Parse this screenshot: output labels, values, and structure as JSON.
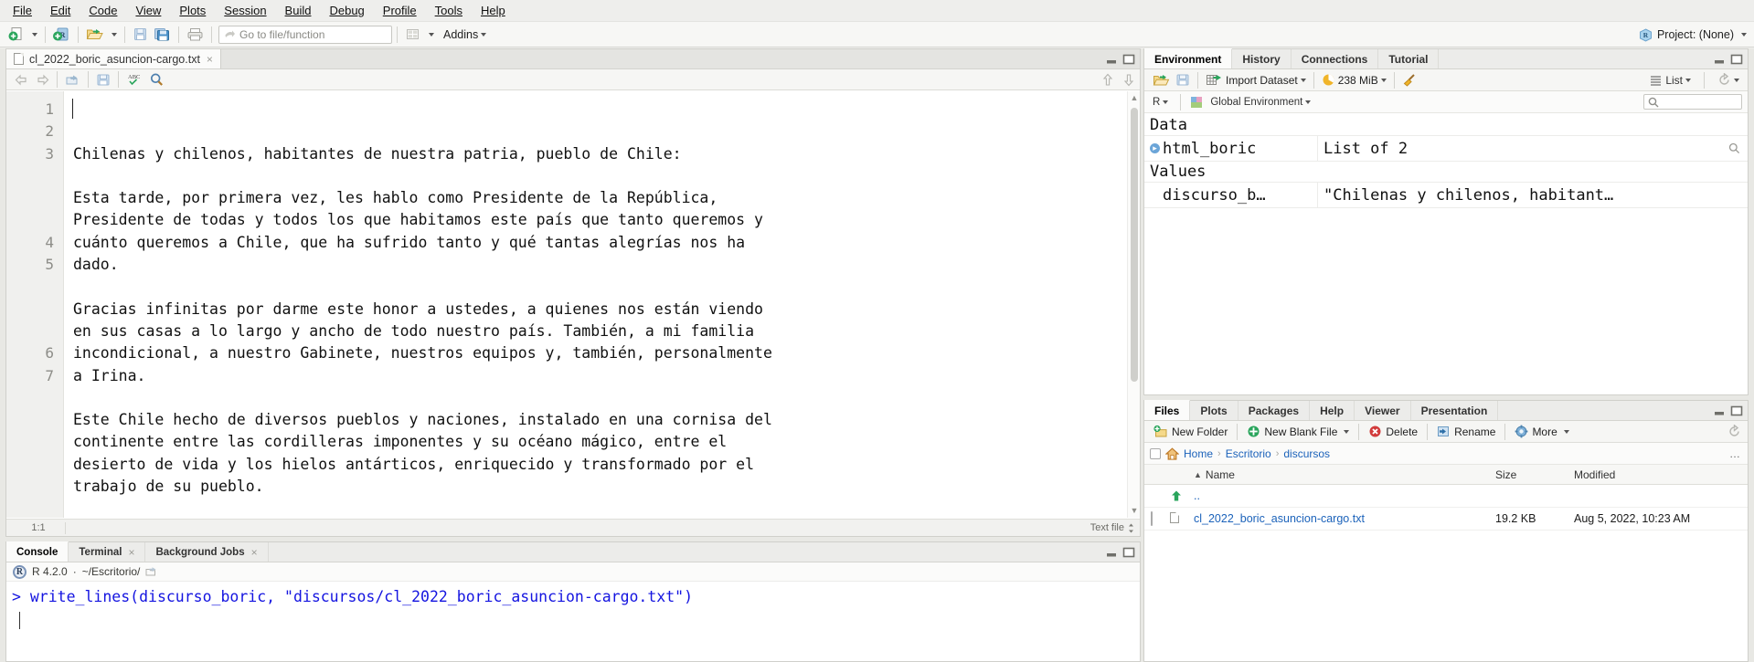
{
  "menubar": {
    "items": [
      "File",
      "Edit",
      "Code",
      "View",
      "Plots",
      "Session",
      "Build",
      "Debug",
      "Profile",
      "Tools",
      "Help"
    ]
  },
  "toolbar": {
    "goto_placeholder": "Go to file/function",
    "addins_label": "Addins",
    "project_label": "Project: (None)"
  },
  "source": {
    "tab_label": "cl_2022_boric_asuncion-cargo.txt",
    "tab_close": "×",
    "status_position": "1:1",
    "status_filetype": "Text file",
    "lines": [
      {
        "num": "1",
        "text": "Chilenas y chilenos, habitantes de nuestra patria, pueblo de Chile:"
      },
      {
        "num": "2",
        "text": ""
      },
      {
        "num": "3",
        "text": "Esta tarde, por primera vez, les hablo como Presidente de la República,\nPresidente de todas y todos los que habitamos este país que tanto queremos y\ncuánto queremos a Chile, que ha sufrido tanto y qué tantas alegrías nos ha\ndado."
      },
      {
        "num": "4",
        "text": ""
      },
      {
        "num": "5",
        "text": "Gracias infinitas por darme este honor a ustedes, a quienes nos están viendo\nen sus casas a lo largo y ancho de todo nuestro país. También, a mi familia\nincondicional, a nuestro Gabinete, nuestros equipos y, también, personalmente\na Irina."
      },
      {
        "num": "6",
        "text": ""
      },
      {
        "num": "7",
        "text": "Este Chile hecho de diversos pueblos y naciones, instalado en una cornisa del\ncontinente entre las cordilleras imponentes y su océano mágico, entre el\ndesierto de vida y los hielos antárticos, enriquecido y transformado por el\ntrabajo de su pueblo."
      }
    ]
  },
  "console": {
    "tabs": [
      {
        "label": "Console",
        "closable": false,
        "active": true
      },
      {
        "label": "Terminal",
        "closable": true,
        "active": false
      },
      {
        "label": "Background Jobs",
        "closable": true,
        "active": false
      }
    ],
    "close_glyph": "×",
    "r_version": "R 4.2.0",
    "separator": "·",
    "working_dir": "~/Escritorio/",
    "prompt_line": "> write_lines(discurso_boric, \"discursos/cl_2022_boric_asuncion-cargo.txt\")"
  },
  "environment": {
    "tabs": [
      "Environment",
      "History",
      "Connections",
      "Tutorial"
    ],
    "active_tab": "Environment",
    "import_dataset_label": "Import Dataset",
    "memory_label": "238 MiB",
    "view_mode_label": "List",
    "language_label": "R",
    "scope_label": "Global Environment",
    "search_placeholder": "",
    "groups": [
      {
        "title": "Data",
        "rows": [
          {
            "name": "html_boric",
            "value": "List of  2",
            "expandable": true,
            "has_view": true
          }
        ]
      },
      {
        "title": "Values",
        "rows": [
          {
            "name": "discurso_b…",
            "value": "\"Chilenas y chilenos, habitant…",
            "expandable": false,
            "has_view": false
          }
        ]
      }
    ]
  },
  "files": {
    "tabs": [
      "Files",
      "Plots",
      "Packages",
      "Help",
      "Viewer",
      "Presentation"
    ],
    "active_tab": "Files",
    "actions": [
      {
        "label": "New Folder",
        "icon": "new-folder-icon",
        "has_caret": false
      },
      {
        "label": "New Blank File",
        "icon": "new-file-icon",
        "has_caret": true
      },
      {
        "label": "Delete",
        "icon": "delete-icon",
        "has_caret": false
      },
      {
        "label": "Rename",
        "icon": "rename-icon",
        "has_caret": false
      },
      {
        "label": "More",
        "icon": "gear-icon",
        "has_caret": true
      }
    ],
    "breadcrumb": [
      "Home",
      "Escritorio",
      "discursos"
    ],
    "breadcrumb_sep": "›",
    "breadcrumb_more": "…",
    "columns": {
      "name": "Name",
      "size": "Size",
      "modified": "Modified",
      "sort_arrow": "▲"
    },
    "rows": [
      {
        "name": "..",
        "size": "",
        "modified": "",
        "type": "parent"
      },
      {
        "name": "cl_2022_boric_asuncion-cargo.txt",
        "size": "19.2 KB",
        "modified": "Aug 5, 2022, 10:23 AM",
        "type": "file"
      }
    ]
  },
  "colors": {
    "accent_blue": "#1b62ba",
    "console_blue": "#1414e0",
    "menu_bg": "#eeeeec",
    "pane_bg": "#ffffff",
    "tab_active": "#fbfbfa"
  }
}
